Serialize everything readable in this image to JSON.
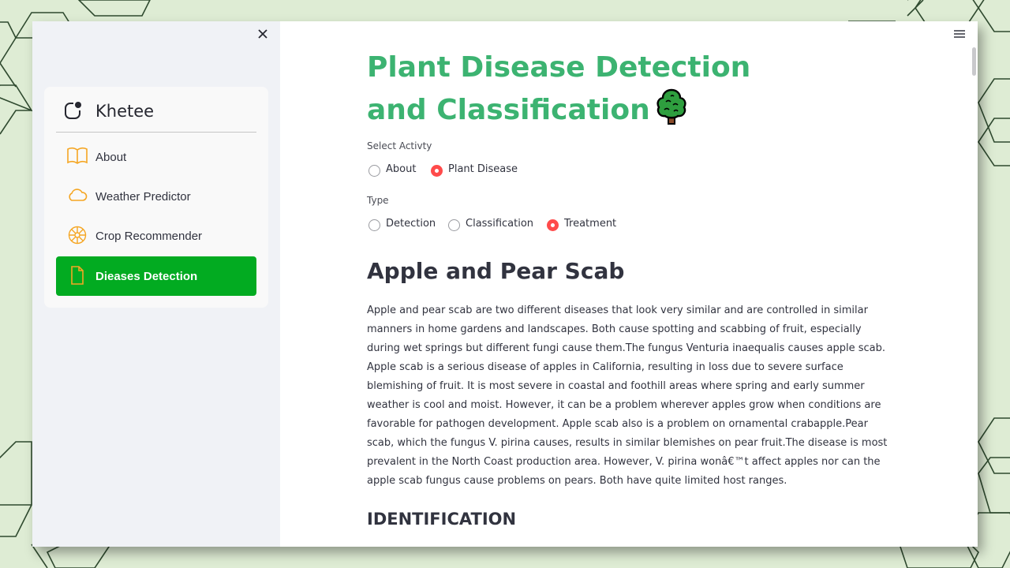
{
  "sidebar": {
    "close_icon": "close-icon",
    "brand": {
      "name": "Khetee",
      "icon": "app-logo-icon"
    },
    "items": [
      {
        "label": "About",
        "icon": "book-icon",
        "active": false
      },
      {
        "label": "Weather Predictor",
        "icon": "cloud-icon",
        "active": false
      },
      {
        "label": "Crop Recommender",
        "icon": "flower-icon",
        "active": false
      },
      {
        "label": "Dieases Detection",
        "icon": "file-icon",
        "active": true
      }
    ]
  },
  "main": {
    "menu_icon": "hamburger-menu-icon",
    "title": "Plant Disease Detection and Classification",
    "title_emoji_icon": "tree-icon",
    "activity": {
      "label": "Select Activty",
      "options": [
        "About",
        "Plant Disease"
      ],
      "selected": "Plant Disease"
    },
    "type": {
      "label": "Type",
      "options": [
        "Detection",
        "Classification",
        "Treatment"
      ],
      "selected": "Treatment"
    },
    "section_title": "Apple and Pear Scab",
    "section_body": "Apple and pear scab are two different diseases that look very similar and are controlled in similar manners in home gardens and landscapes. Both cause spotting and scabbing of fruit, especially during wet springs but different fungi cause them.The fungus Venturia inaequalis causes apple scab. Apple scab is a serious disease of apples in California, resulting in loss due to severe surface blemishing of fruit. It is most severe in coastal and foothill areas where spring and early summer weather is cool and moist. However, it can be a problem wherever apples grow when conditions are favorable for pathogen development. Apple scab also is a problem on ornamental crabapple.Pear scab, which the fungus V. pirina causes, results in similar blemishes on pear fruit.The disease is most prevalent in the North Coast production area. However, V. pirina wonâ€™t affect apples nor can the apple scab fungus cause problems on pears. Both have quite limited host ranges.",
    "subsection_title": "IDENTIFICATION"
  },
  "colors": {
    "accent_green": "#3cb371",
    "nav_active_bg": "#02ab21",
    "radio_selected": "#ff4b4b",
    "icon_orange": "#f5a623",
    "background": "#deecd4"
  }
}
